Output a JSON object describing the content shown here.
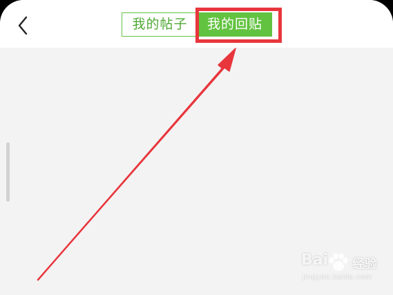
{
  "header": {
    "back_icon": "chevron-left-icon",
    "tabs": [
      {
        "label": "我的帖子",
        "selected": false
      },
      {
        "label": "我的回贴",
        "selected": true
      }
    ]
  },
  "colors": {
    "accent_green": "#62c341",
    "annotation_red": "#e8363d",
    "background": "#f3f3f3"
  },
  "watermark": {
    "brand": "Bai",
    "sub": "经验",
    "url": "jingyan.baidu.com"
  }
}
